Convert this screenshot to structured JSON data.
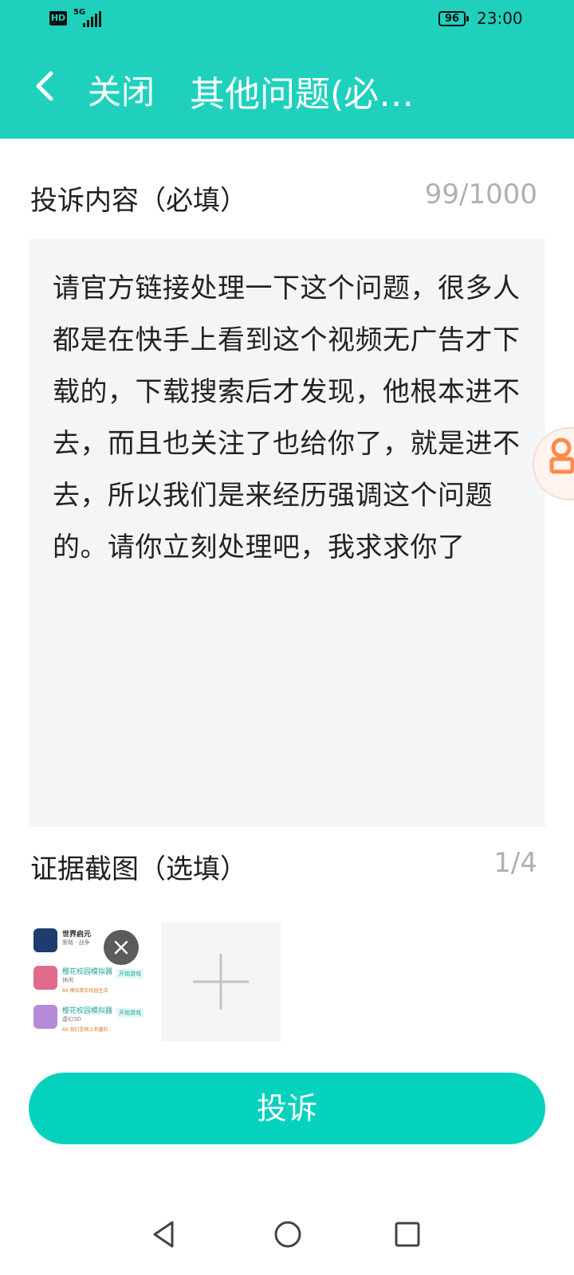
{
  "status_bar": {
    "hd_label": "HD",
    "network_label": "5G",
    "battery_level": "96",
    "time": "23:00"
  },
  "header": {
    "close_label": "关闭",
    "title": "其他问题(必…"
  },
  "complaint": {
    "label": "投诉内容（必填）",
    "counter": "99/1000",
    "text": "请官方链接处理一下这个问题，很多人都是在快手上看到这个视频无广告才下载的，下载搜索后才发现，他根本进不去，而且也关注了也给你了，就是进不去，所以我们是来经历强调这个问题的。请你立刻处理吧，我求求你了"
  },
  "evidence": {
    "label": "证据截图（选填）",
    "counter": "1/4",
    "thumbnail": {
      "apps": [
        {
          "name": "世界启元",
          "sub": "策略 · 战争",
          "note": "",
          "button": ""
        },
        {
          "name": "樱花校园模拟器",
          "sub": "休闲",
          "note": "66 模拟真实校园生活",
          "button": "开始游戏"
        },
        {
          "name": "樱花校园模拟器",
          "sub": "虚幻3D",
          "note": "66 我们是网上有趣的",
          "button": "开始游戏"
        }
      ]
    }
  },
  "submit_label": "投诉",
  "colors": {
    "brand": "#1fd1bd",
    "button": "#05d2bd",
    "input_bg": "#f4f5f7",
    "muted": "#b0b0b0"
  },
  "icons": [
    "back-chevron-icon",
    "remove-x-icon",
    "plus-icon",
    "nav-back-icon",
    "nav-home-icon",
    "nav-recents-icon"
  ]
}
